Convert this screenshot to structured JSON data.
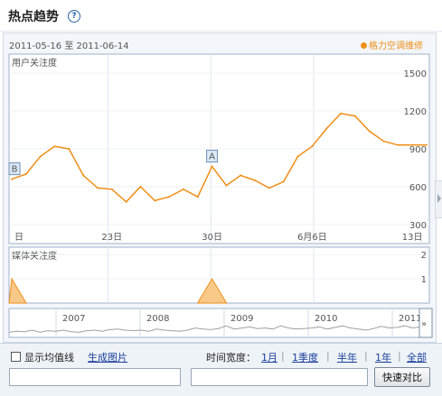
{
  "header": {
    "title": "热点趋势",
    "help_icon": "?"
  },
  "date_range": {
    "start": "2011-05-16",
    "to": "至",
    "end": "2011-06-14"
  },
  "legend_label": "格力空调维修",
  "colors": {
    "series": "#ef8f18",
    "fill": "#f9c98a",
    "overview": "#a0a0a0"
  },
  "chart_data": [
    {
      "type": "line",
      "title": "用户关注度",
      "x": [
        "5-16",
        "5-17",
        "5-18",
        "5-19",
        "5-20",
        "5-21",
        "5-22",
        "5-23",
        "5-24",
        "5-25",
        "5-26",
        "5-27",
        "5-28",
        "5-29",
        "5-30",
        "5-31",
        "6-01",
        "6-02",
        "6-03",
        "6-04",
        "6-05",
        "6-06",
        "6-07",
        "6-08",
        "6-09",
        "6-10",
        "6-11",
        "6-12",
        "6-13",
        "6-14"
      ],
      "series": [
        {
          "values": [
            660,
            700,
            840,
            920,
            900,
            690,
            590,
            580,
            480,
            600,
            490,
            520,
            580,
            520,
            760,
            610,
            690,
            650,
            590,
            640,
            840,
            920,
            1060,
            1180,
            1160,
            1040,
            960,
            930,
            930,
            930
          ]
        }
      ],
      "x_tick_labels": [
        "日",
        "23日",
        "30日",
        "6月6日",
        "13日"
      ],
      "y_ticks": [
        300,
        600,
        900,
        1200,
        1500
      ],
      "ylim": [
        150,
        1650
      ],
      "annotations": [
        {
          "x": "5-16",
          "label": "B"
        },
        {
          "x": "5-30",
          "label": "A"
        }
      ],
      "grid": true
    },
    {
      "type": "area",
      "title": "媒体关注度",
      "x": [
        "5-16",
        "5-17",
        "5-18",
        "5-19",
        "5-20",
        "5-21",
        "5-22",
        "5-23",
        "5-24",
        "5-25",
        "5-26",
        "5-27",
        "5-28",
        "5-29",
        "5-30",
        "5-31",
        "6-01",
        "6-02",
        "6-03",
        "6-04",
        "6-05",
        "6-06",
        "6-07",
        "6-08",
        "6-09",
        "6-10",
        "6-11",
        "6-12",
        "6-13",
        "6-14"
      ],
      "series": [
        {
          "values": [
            1,
            0,
            0,
            0,
            0,
            0,
            0,
            0,
            0,
            0,
            0,
            0,
            0,
            0,
            1,
            0,
            0,
            0,
            0,
            0,
            0,
            0,
            0,
            0,
            0,
            0,
            0,
            0,
            0,
            0
          ]
        }
      ],
      "y_ticks": [
        1,
        2
      ],
      "ylim": [
        0,
        2.3
      ],
      "grid": true
    },
    {
      "type": "line",
      "title": "",
      "x_tick_labels": [
        "2007",
        "2008",
        "2009",
        "2010",
        "2011"
      ],
      "series": [
        {
          "values": [
            0.3,
            0.4,
            0.35,
            0.5,
            0.3,
            0.45,
            0.4,
            0.5,
            0.35,
            0.3,
            0.45,
            0.5,
            0.4,
            0.55,
            0.6,
            0.5,
            0.45,
            0.5,
            0.4,
            0.6,
            0.5,
            0.45,
            0.4,
            0.5,
            0.7,
            0.6,
            0.55,
            0.65,
            0.9,
            0.6,
            0.7,
            0.8,
            0.65,
            0.7,
            0.6,
            0.9,
            0.7,
            0.6,
            0.65,
            0.7,
            0.8,
            0.6,
            0.75,
            0.9,
            0.7,
            0.6,
            0.5,
            0.65,
            0.85,
            0.7,
            0.75,
            0.9,
            0.7,
            0.8
          ]
        }
      ]
    }
  ],
  "footer": {
    "show_average": "显示均值线",
    "generate_image": "生成图片",
    "time_width_label": "时间宽度：",
    "options": [
      "1月",
      "1季度",
      "半年",
      "1年",
      "全部"
    ],
    "compare_button": "快速对比"
  }
}
